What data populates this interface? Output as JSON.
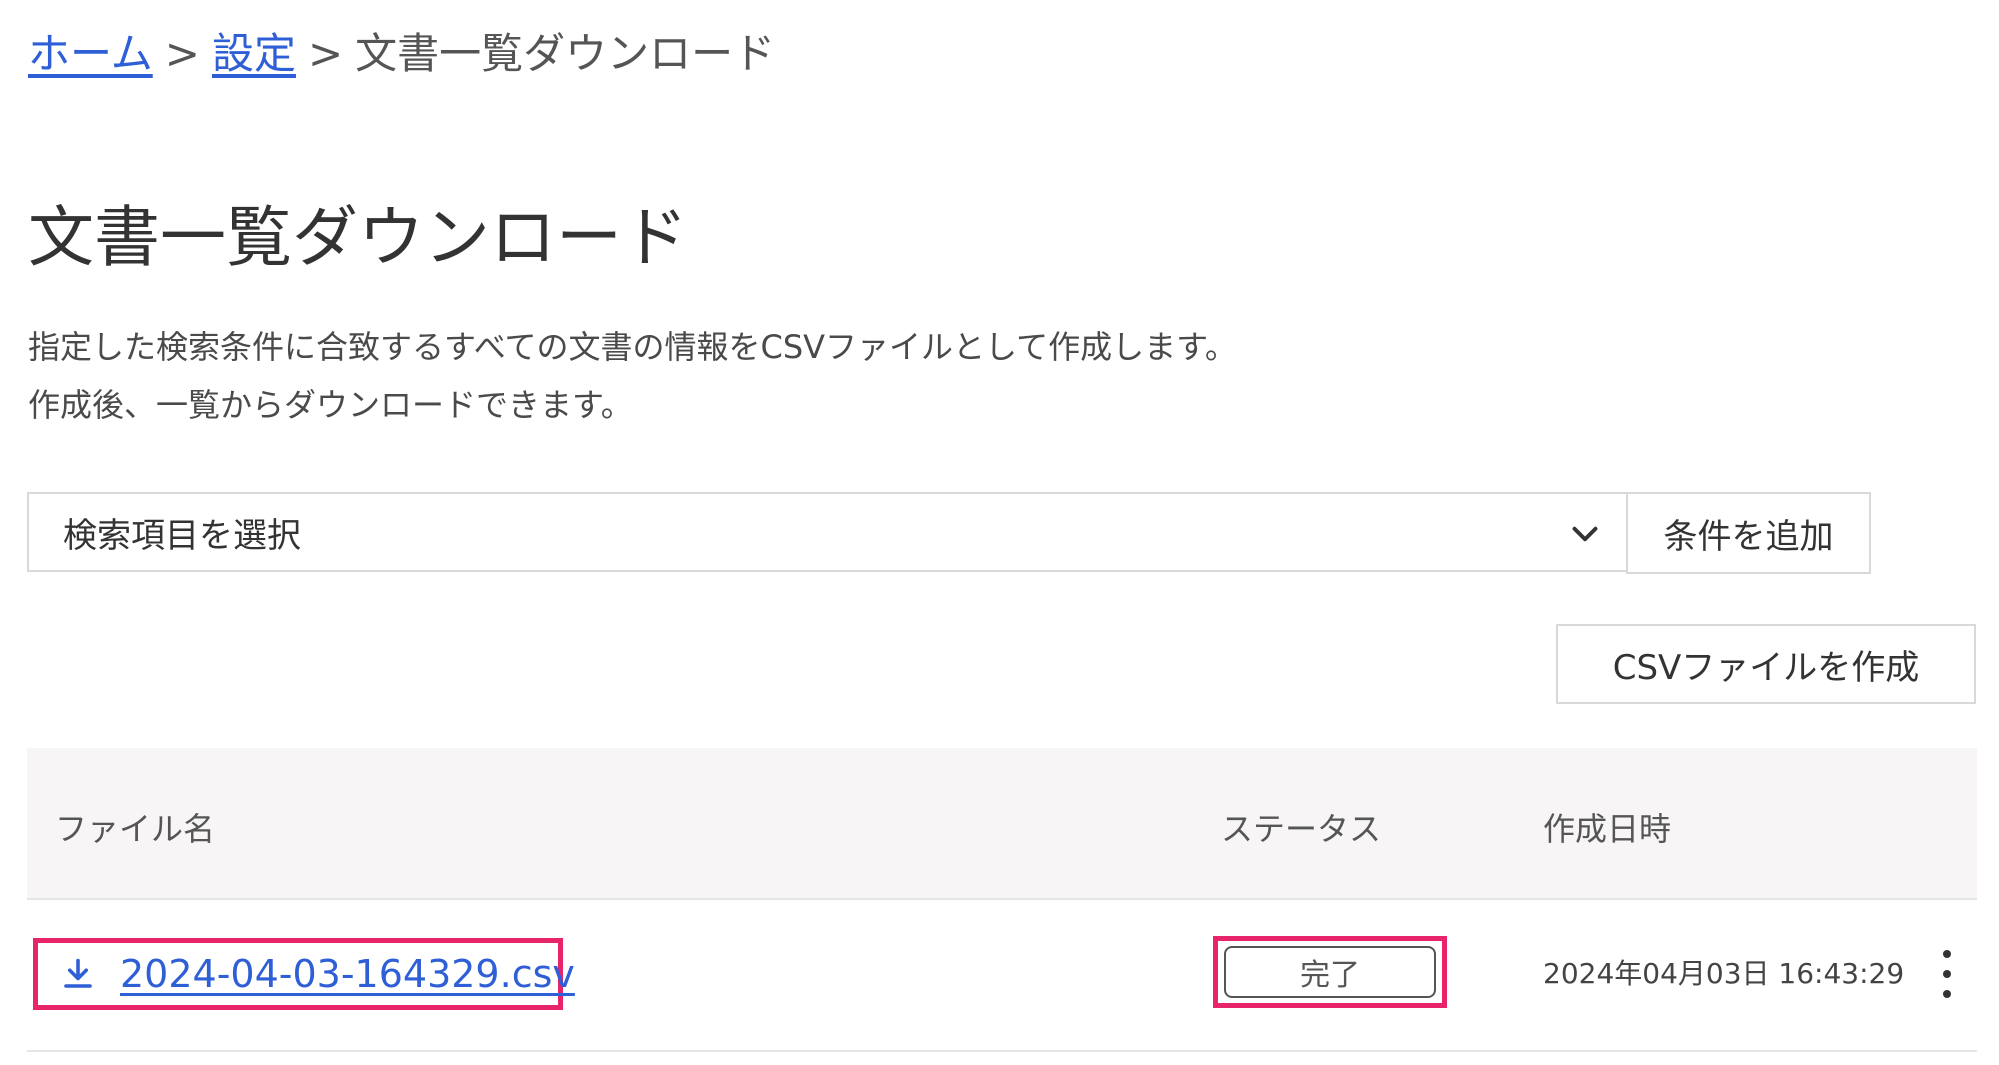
{
  "breadcrumb": {
    "items": [
      {
        "label": "ホーム"
      },
      {
        "label": "設定"
      },
      {
        "label": "文書一覧ダウンロード"
      }
    ],
    "separator": ">"
  },
  "page": {
    "title": "文書一覧ダウンロード",
    "description_lines": [
      "指定した検索条件に合致するすべての文書の情報をCSVファイルとして作成します。",
      "作成後、一覧からダウンロードできます。"
    ]
  },
  "filter": {
    "select_value": "検索項目を選択",
    "add_condition_label": "条件を追加"
  },
  "actions": {
    "create_csv_label": "CSVファイルを作成"
  },
  "table": {
    "columns": [
      "ファイル名",
      "ステータス",
      "作成日時"
    ],
    "rows": [
      {
        "file_name": "2024-04-03-164329.csv",
        "status": "完了",
        "created_at": "2024年04月03日 16:43:29"
      }
    ]
  },
  "colors": {
    "link": "#2f5fd6",
    "highlight": "#e8246b",
    "header_bg": "#f7f5f5"
  },
  "icons": {
    "select_indicator": "chevron-down-icon",
    "row_file": "download-icon",
    "row_menu": "more-vertical-icon"
  }
}
